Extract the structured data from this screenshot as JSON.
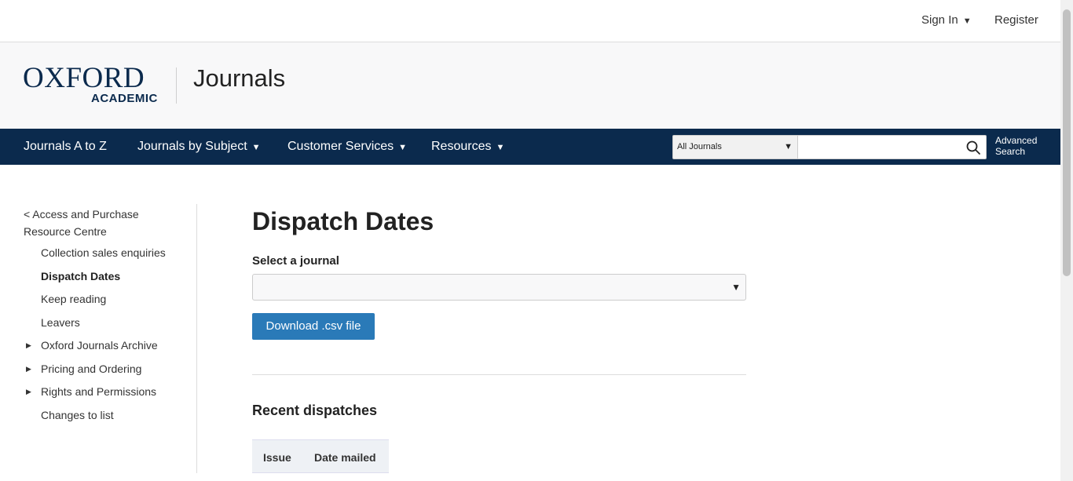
{
  "topbar": {
    "sign_in": "Sign In",
    "register": "Register"
  },
  "brand": {
    "oxford": "OXFORD",
    "academic": "ACADEMIC",
    "section": "Journals"
  },
  "nav": {
    "items": [
      {
        "label": "Journals A to Z",
        "has_dropdown": false
      },
      {
        "label": "Journals by Subject",
        "has_dropdown": true
      },
      {
        "label": "Customer Services",
        "has_dropdown": true
      },
      {
        "label": "Resources",
        "has_dropdown": true
      }
    ],
    "search_scope": "All Journals",
    "search_value": "",
    "advanced_line1": "Advanced",
    "advanced_line2": "Search"
  },
  "sidebar": {
    "back_link": "< Access and Purchase Resource Centre",
    "items": [
      {
        "label": "Collection sales enquiries",
        "active": false,
        "expandable": false
      },
      {
        "label": "Dispatch Dates",
        "active": true,
        "expandable": false
      },
      {
        "label": "Keep reading",
        "active": false,
        "expandable": false
      },
      {
        "label": "Leavers",
        "active": false,
        "expandable": false
      },
      {
        "label": "Oxford Journals Archive",
        "active": false,
        "expandable": true
      },
      {
        "label": "Pricing and Ordering",
        "active": false,
        "expandable": true
      },
      {
        "label": "Rights and Permissions",
        "active": false,
        "expandable": true
      },
      {
        "label": "Changes to list",
        "active": false,
        "expandable": false
      }
    ]
  },
  "main": {
    "title": "Dispatch Dates",
    "select_label": "Select a journal",
    "select_value": "",
    "download_label": "Download .csv file",
    "recent_heading": "Recent dispatches",
    "table_headers": [
      "Issue",
      "Date mailed"
    ]
  },
  "colors": {
    "navy": "#0b2a4d",
    "button_blue": "#2a7ab8"
  }
}
